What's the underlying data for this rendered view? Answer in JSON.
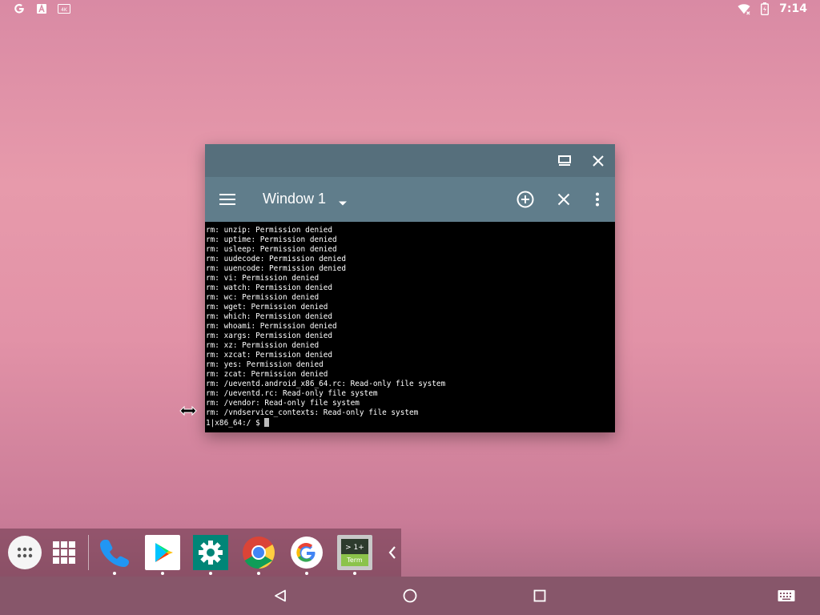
{
  "status_bar": {
    "left_icons": [
      "google-g-icon",
      "text-a-icon",
      "4k-icon"
    ],
    "right_icons": [
      "wifi-icon",
      "battery-icon"
    ],
    "time": "7:14"
  },
  "window": {
    "title": "Window 1",
    "terminal_lines": [
      "rm: unzip: Permission denied",
      "rm: uptime: Permission denied",
      "rm: usleep: Permission denied",
      "rm: uudecode: Permission denied",
      "rm: uuencode: Permission denied",
      "rm: vi: Permission denied",
      "rm: watch: Permission denied",
      "rm: wc: Permission denied",
      "rm: wget: Permission denied",
      "rm: which: Permission denied",
      "rm: whoami: Permission denied",
      "rm: xargs: Permission denied",
      "rm: xz: Permission denied",
      "rm: xzcat: Permission denied",
      "rm: yes: Permission denied",
      "rm: zcat: Permission denied",
      "rm: /ueventd.android_x86_64.rc: Read-only file system",
      "rm: /ueventd.rc: Read-only file system",
      "rm: /vendor: Read-only file system",
      "rm: /vndservice_contexts: Read-only file system"
    ],
    "prompt": "1|x86_64:/ $ "
  },
  "taskbar": {
    "apps": [
      "all-apps",
      "recents-grid",
      "phone",
      "play-store",
      "settings",
      "chrome",
      "google",
      "terminal"
    ],
    "terminal_icon_text": "> 1+",
    "terminal_icon_label": "Term"
  },
  "colors": {
    "caption": "#566f7c",
    "toolbar": "#607d8b",
    "navbar": "#87566a"
  }
}
